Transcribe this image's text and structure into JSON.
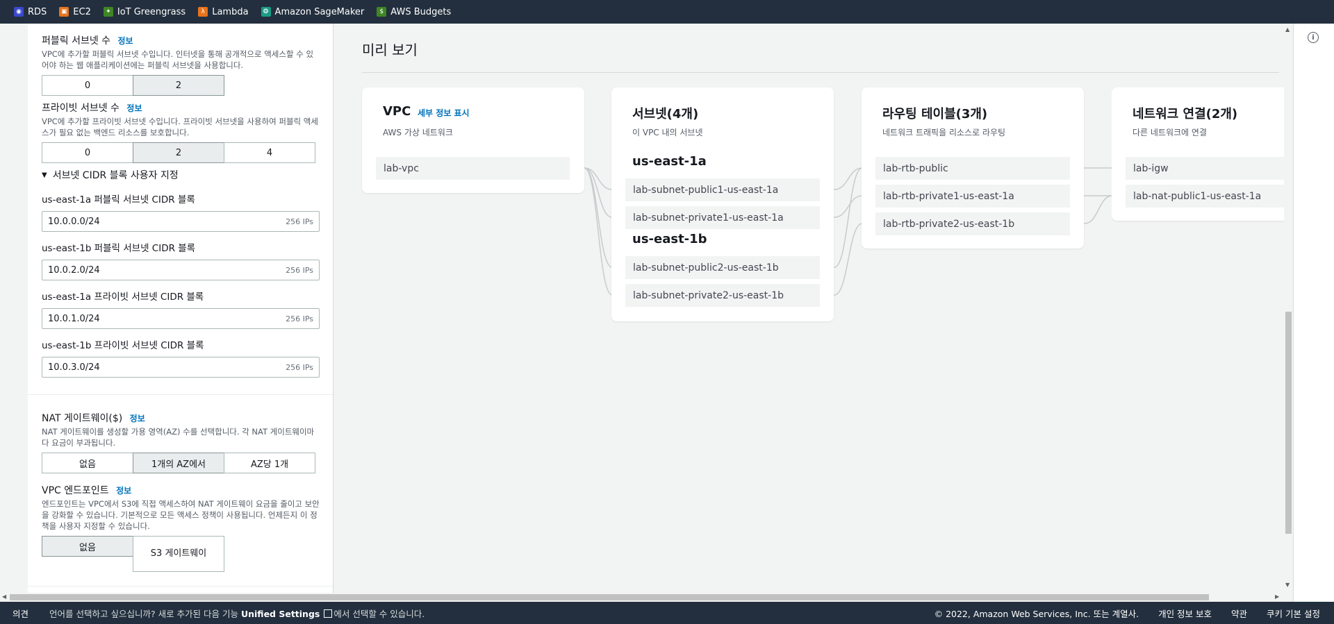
{
  "favorites": [
    {
      "label": "RDS",
      "icon": "rds-icon",
      "color": "#3b48cc"
    },
    {
      "label": "EC2",
      "icon": "ec2-icon",
      "color": "#e7731c"
    },
    {
      "label": "IoT Greengrass",
      "icon": "iot-greengrass-icon",
      "color": "#3f8624"
    },
    {
      "label": "Lambda",
      "icon": "lambda-icon",
      "color": "#e7731c"
    },
    {
      "label": "Amazon SageMaker",
      "icon": "sagemaker-icon",
      "color": "#1a9c88"
    },
    {
      "label": "AWS Budgets",
      "icon": "budgets-icon",
      "color": "#3f8624"
    }
  ],
  "left": {
    "public_subnets": {
      "title": "퍼블릭 서브넷 수",
      "info": "정보",
      "desc": "VPC에 추가할 퍼블릭 서브넷 수입니다. 인터넷을 통해 공개적으로 액세스할 수 있어야 하는 웹 애플리케이션에는 퍼블릭 서브넷을 사용합니다.",
      "options": [
        "0",
        "2"
      ],
      "selected": "2"
    },
    "private_subnets": {
      "title": "프라이빗 서브넷 수",
      "info": "정보",
      "desc": "VPC에 추가할 프라이빗 서브넷 수입니다. 프라이빗 서브넷을 사용하여 퍼블릭 액세스가 필요 없는 백엔드 리소스를 보호합니다.",
      "options": [
        "0",
        "2",
        "4"
      ],
      "selected": "2"
    },
    "cidr_customize": {
      "label": "서브넷 CIDR 블록 사용자 지정",
      "fields": [
        {
          "label": "us-east-1a 퍼블릭 서브넷 CIDR 블록",
          "value": "10.0.0.0/24",
          "suffix": "256 IPs"
        },
        {
          "label": "us-east-1b 퍼블릭 서브넷 CIDR 블록",
          "value": "10.0.2.0/24",
          "suffix": "256 IPs"
        },
        {
          "label": "us-east-1a 프라이빗 서브넷 CIDR 블록",
          "value": "10.0.1.0/24",
          "suffix": "256 IPs"
        },
        {
          "label": "us-east-1b 프라이빗 서브넷 CIDR 블록",
          "value": "10.0.3.0/24",
          "suffix": "256 IPs"
        }
      ]
    },
    "nat": {
      "title": "NAT 게이트웨이($)",
      "info": "정보",
      "desc": "NAT 게이트웨이를 생성할 가용 영역(AZ) 수를 선택합니다. 각 NAT 게이트웨이마다 요금이 부과됩니다.",
      "options": [
        "없음",
        "1개의 AZ에서",
        "AZ당 1개"
      ],
      "selected": "1개의 AZ에서"
    },
    "endpoint": {
      "title": "VPC 엔드포인트",
      "info": "정보",
      "desc": "엔드포인트는 VPC에서 S3에 직접 액세스하여 NAT 게이트웨이 요금을 줄이고 보안을 강화할 수 있습니다. 기본적으로 모든 액세스 정책이 사용됩니다. 언제든지 이 정책을 사용자 지정할 수 있습니다.",
      "options": [
        "없음",
        "S3 게이트웨이"
      ],
      "selected": "없음"
    }
  },
  "preview": {
    "title": "미리 보기",
    "vpc": {
      "title": "VPC",
      "link": "세부 정보 표시",
      "sub": "AWS 가상 네트워크",
      "items": [
        "lab-vpc"
      ]
    },
    "subnets": {
      "title": "서브넷(4개)",
      "sub": "이 VPC 내의 서브넷",
      "az1": "us-east-1a",
      "az1_items": [
        "lab-subnet-public1-us-east-1a",
        "lab-subnet-private1-us-east-1a"
      ],
      "az2": "us-east-1b",
      "az2_items": [
        "lab-subnet-public2-us-east-1b",
        "lab-subnet-private2-us-east-1b"
      ]
    },
    "routes": {
      "title": "라우팅 테이블(3개)",
      "sub": "네트워크 트래픽을 리소스로 라우팅",
      "items": [
        "lab-rtb-public",
        "lab-rtb-private1-us-east-1a",
        "lab-rtb-private2-us-east-1b"
      ]
    },
    "network": {
      "title": "네트워크 연결(2개)",
      "sub": "다른 네트워크에 연결",
      "items": [
        "lab-igw",
        "lab-nat-public1-us-east-1a"
      ]
    }
  },
  "footer": {
    "feedback": "의견",
    "lang_prefix": "언어를 선택하고 싶으십니까? 새로 추가된 다음 기능 ",
    "lang_link": "Unified Settings",
    "lang_suffix": "에서 선택할 수 있습니다.",
    "copyright": "© 2022, Amazon Web Services, Inc. 또는 계열사.",
    "privacy": "개인 정보 보호",
    "terms": "약관",
    "cookies": "쿠키 기본 설정"
  }
}
